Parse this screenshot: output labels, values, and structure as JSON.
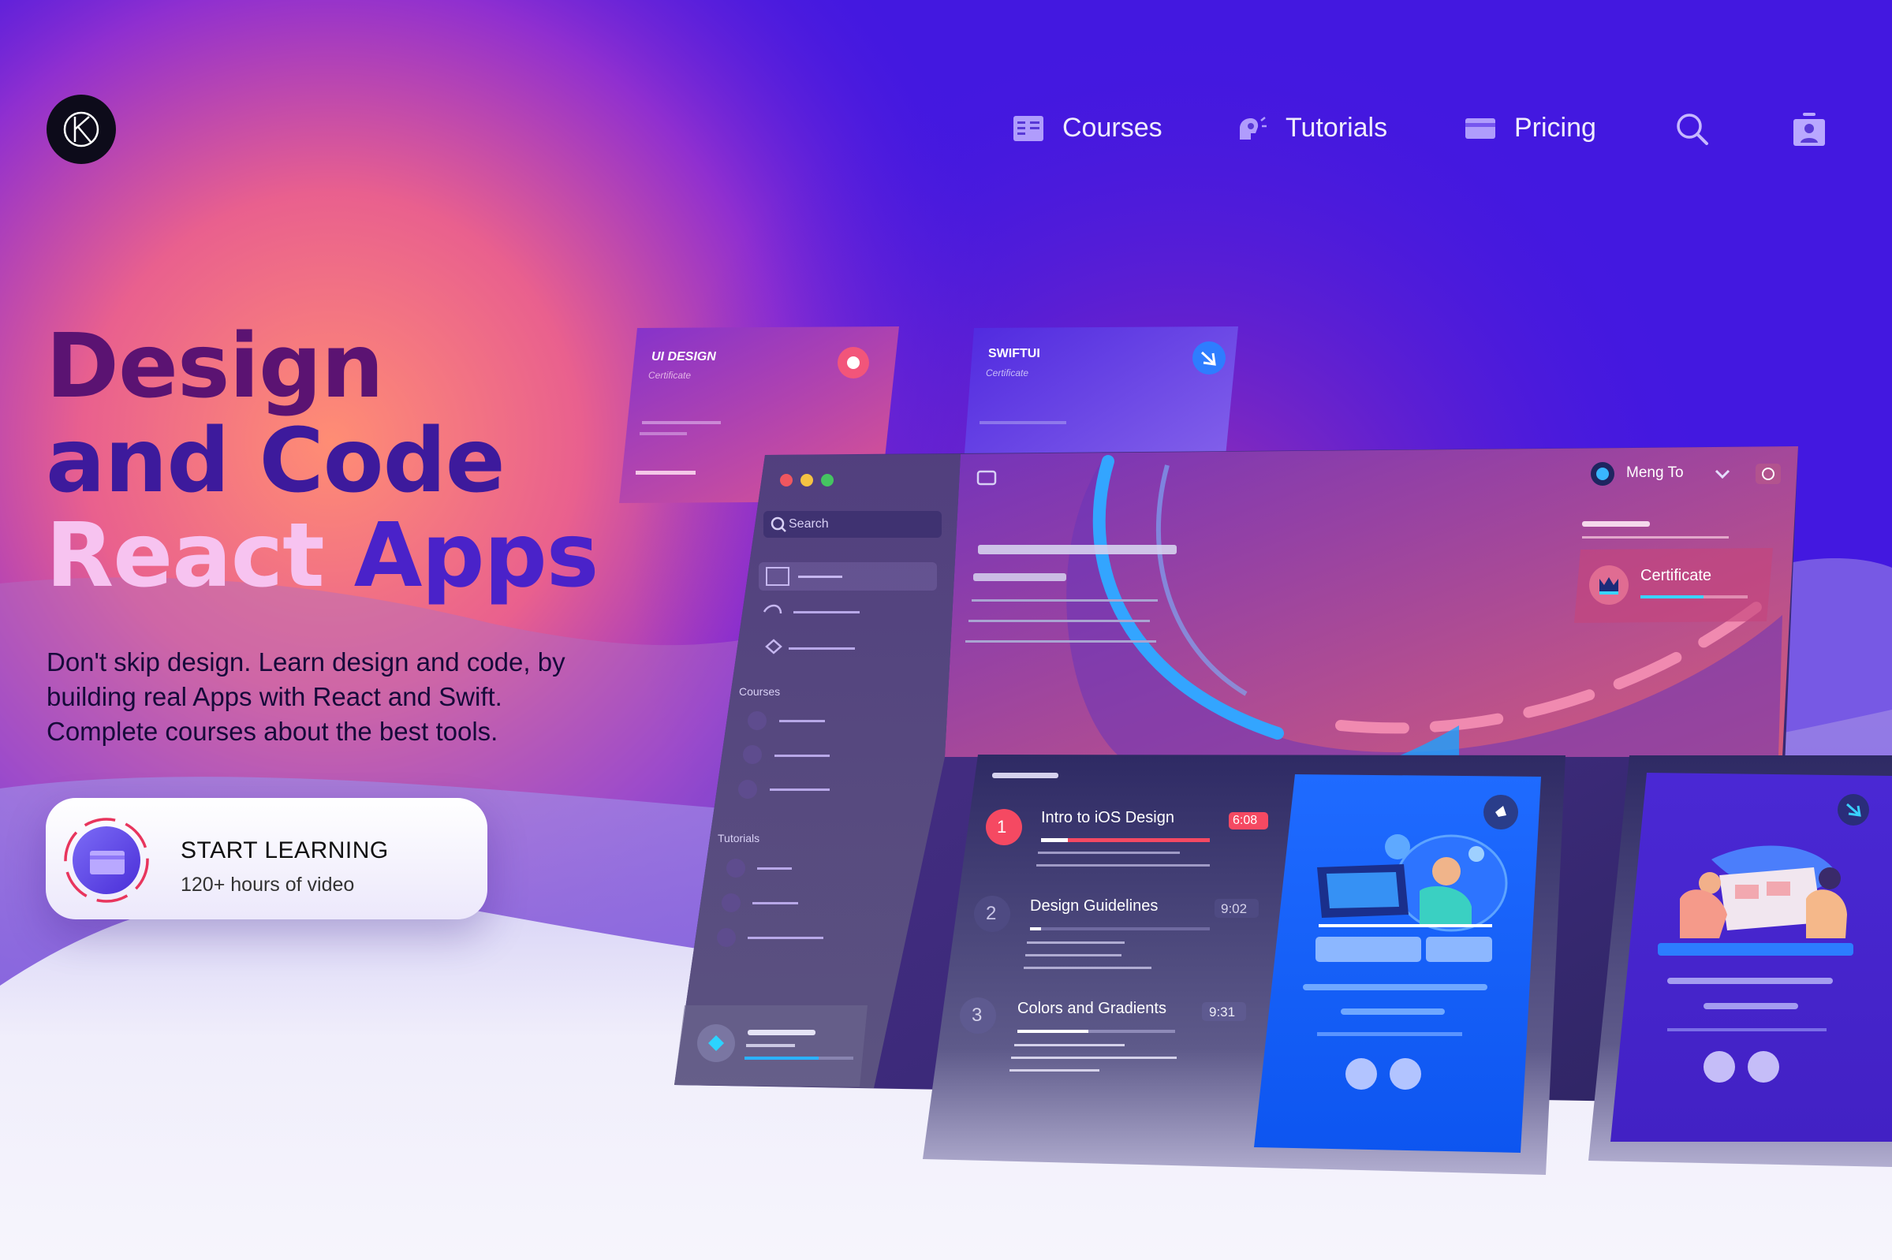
{
  "header": {
    "nav": [
      {
        "label": "Courses",
        "icon": "courses-icon"
      },
      {
        "label": "Tutorials",
        "icon": "tutorials-icon"
      },
      {
        "label": "Pricing",
        "icon": "pricing-icon"
      }
    ],
    "search_icon": "search-icon",
    "account_icon": "account-icon",
    "logo_icon": "logo-icon"
  },
  "hero": {
    "headline_line1": "Design",
    "headline_line2": "and Code",
    "headline_line3_a": "React",
    "headline_line3_b": " Apps",
    "subtitle": "Don't skip design. Learn design and code, by building real Apps with React and Swift. Complete courses about the best tools.",
    "cta_title": "START LEARNING",
    "cta_subtitle": "120+ hours of video"
  },
  "mockup": {
    "card_uidesign_title": "UI DESIGN",
    "card_uidesign_sub": "Certificate",
    "card_swiftui_title": "SWIFTUI",
    "card_swiftui_sub": "Certificate",
    "search_placeholder": "Search",
    "section_courses": "Courses",
    "section_tutorials": "Tutorials",
    "user_name": "Meng To",
    "certificate_label": "Certificate",
    "lessons": [
      {
        "num": "1",
        "title": "Intro to iOS Design",
        "duration": "6:08"
      },
      {
        "num": "2",
        "title": "Design Guidelines",
        "duration": "9:02"
      },
      {
        "num": "3",
        "title": "Colors and Gradients",
        "duration": "9:31"
      }
    ]
  },
  "colors": {
    "background_top": "#4318e0",
    "accent_pink": "#f0567a",
    "accent_blue": "#1f6bff",
    "headline_dark": "#5b1372"
  }
}
